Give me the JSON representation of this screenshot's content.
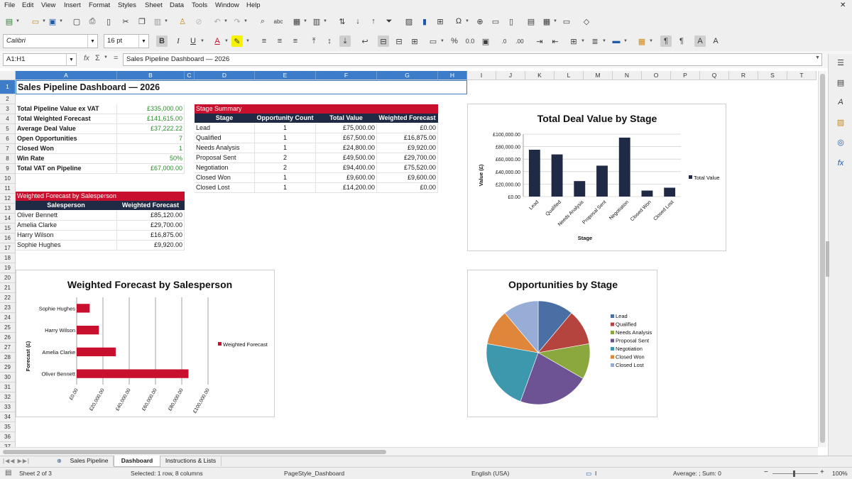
{
  "menu": [
    "File",
    "Edit",
    "View",
    "Insert",
    "Format",
    "Styles",
    "Sheet",
    "Data",
    "Tools",
    "Window",
    "Help"
  ],
  "toolbar2": {
    "font_name": "Calibri",
    "font_size": "16 pt"
  },
  "formula_bar": {
    "name_box": "A1:H1",
    "formula_icon": "fx",
    "sum_icon": "Σ",
    "equals": "=",
    "content": "Sales Pipeline Dashboard — 2026"
  },
  "columns": [
    "A",
    "B",
    "C",
    "D",
    "E",
    "F",
    "G",
    "H",
    "I",
    "J",
    "K",
    "L",
    "M",
    "N",
    "O",
    "P",
    "Q",
    "R",
    "S",
    "T"
  ],
  "rows": [
    "1",
    "2",
    "3",
    "4",
    "5",
    "6",
    "7",
    "8",
    "9",
    "10",
    "11",
    "12",
    "13",
    "14",
    "15",
    "16",
    "17",
    "18",
    "19",
    "20",
    "21",
    "22",
    "23",
    "24",
    "25",
    "26",
    "27",
    "28",
    "29",
    "30",
    "31",
    "32",
    "33",
    "34",
    "35",
    "36",
    "37"
  ],
  "title": "Sales Pipeline Dashboard — 2026",
  "kpis": [
    {
      "label": "Total Pipeline Value ex VAT",
      "value": "£335,000.00"
    },
    {
      "label": "Total Weighted Forecast",
      "value": "£141,615.00"
    },
    {
      "label": "Average Deal Value",
      "value": "£37,222.22"
    },
    {
      "label": "Open Opportunities",
      "value": "7"
    },
    {
      "label": "Closed Won",
      "value": "1"
    },
    {
      "label": "Win Rate",
      "value": "50%"
    },
    {
      "label": "Total VAT on Pipeline",
      "value": "£67,000.00"
    }
  ],
  "stage_summary": {
    "title": "Stage Summary",
    "headers": [
      "Stage",
      "Opportunity Count",
      "Total Value",
      "Weighted Forecast"
    ],
    "rows": [
      [
        "Lead",
        "1",
        "£75,000.00",
        "£0.00"
      ],
      [
        "Qualified",
        "1",
        "£67,500.00",
        "£16,875.00"
      ],
      [
        "Needs Analysis",
        "1",
        "£24,800.00",
        "£9,920.00"
      ],
      [
        "Proposal Sent",
        "2",
        "£49,500.00",
        "£29,700.00"
      ],
      [
        "Negotiation",
        "2",
        "£94,400.00",
        "£75,520.00"
      ],
      [
        "Closed Won",
        "1",
        "£9,600.00",
        "£9,600.00"
      ],
      [
        "Closed Lost",
        "1",
        "£14,200.00",
        "£0.00"
      ]
    ]
  },
  "salesperson": {
    "title": "Weighted Forecast by Salesperson",
    "headers": [
      "Salesperson",
      "Weighted Forecast"
    ],
    "rows": [
      [
        "Oliver Bennett",
        "£85,120.00"
      ],
      [
        "Amelia Clarke",
        "£29,700.00"
      ],
      [
        "Harry Wilson",
        "£16,875.00"
      ],
      [
        "Sophie Hughes",
        "£9,920.00"
      ]
    ]
  },
  "chart_data": [
    {
      "type": "bar",
      "title": "Total Deal Value by Stage",
      "xlabel": "Stage",
      "ylabel": "Value (£)",
      "categories": [
        "Lead",
        "Qualified",
        "Needs Analysis",
        "Proposal Sent",
        "Negotiation",
        "Closed Won",
        "Closed Lost"
      ],
      "series": [
        {
          "name": "Total Value",
          "values": [
            75000,
            67500,
            24800,
            49500,
            94400,
            9600,
            14200
          ]
        }
      ],
      "ylim": [
        0,
        100000
      ],
      "ticks": [
        "£0.00",
        "£20,000.00",
        "£40,000.00",
        "£60,000.00",
        "£80,000.00",
        "£100,000.00"
      ],
      "color": "#1f2a44",
      "legend": "right"
    },
    {
      "type": "bar",
      "orientation": "horizontal",
      "title": "Weighted Forecast by Salesperson",
      "ylabel": "Forecast (£)",
      "categories": [
        "Sophie Hughes",
        "Harry Wilson",
        "Amelia Clarke",
        "Oliver Bennett"
      ],
      "series": [
        {
          "name": "Weighted Forecast",
          "values": [
            9920,
            16875,
            29700,
            85120
          ]
        }
      ],
      "xlim": [
        0,
        100000
      ],
      "ticks": [
        "£0.00",
        "£20,000.00",
        "£40,000.00",
        "£60,000.00",
        "£80,000.00",
        "£100,000.00"
      ],
      "color": "#c8102e",
      "legend": "right"
    },
    {
      "type": "pie",
      "title": "Opportunities by Stage",
      "categories": [
        "Lead",
        "Qualified",
        "Needs Analysis",
        "Proposal Sent",
        "Negotiation",
        "Closed Won",
        "Closed Lost"
      ],
      "values": [
        1,
        1,
        1,
        2,
        2,
        1,
        1
      ],
      "colors": [
        "#4a6fa5",
        "#b5443f",
        "#8aa83e",
        "#6d5394",
        "#3d98ad",
        "#e0863b",
        "#97add6"
      ],
      "legend": "right"
    }
  ],
  "sheet_tabs": [
    "Sales Pipeline",
    "Dashboard",
    "Instructions & Lists"
  ],
  "active_tab": "Dashboard",
  "status": {
    "sheet": "Sheet 2 of 3",
    "selection": "Selected: 1 row, 8 columns",
    "page_style": "PageStyle_Dashboard",
    "language": "English (USA)",
    "sum": "Average: ; Sum: 0",
    "zoom": "100%"
  }
}
